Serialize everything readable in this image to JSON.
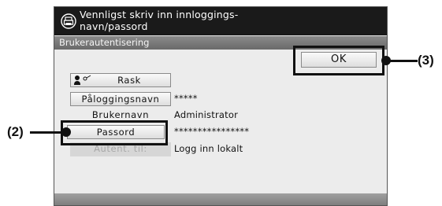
{
  "dialog": {
    "title_line1": "Vennligst skriv inn innloggings-",
    "title_line2": "navn/passord",
    "subtitle": "Brukerautentisering"
  },
  "buttons": {
    "ok": "OK",
    "quick": "Rask",
    "login_name": "Påloggingsnavn",
    "user_name": "Brukernavn",
    "password": "Passord",
    "auth_to": "Autent. til:"
  },
  "values": {
    "login_name": "*****",
    "user_name": "Administrator",
    "password": "****************",
    "auth_to": "Logg inn lokalt"
  },
  "callouts": {
    "password_label": "(2)",
    "ok_label": "(3)"
  }
}
